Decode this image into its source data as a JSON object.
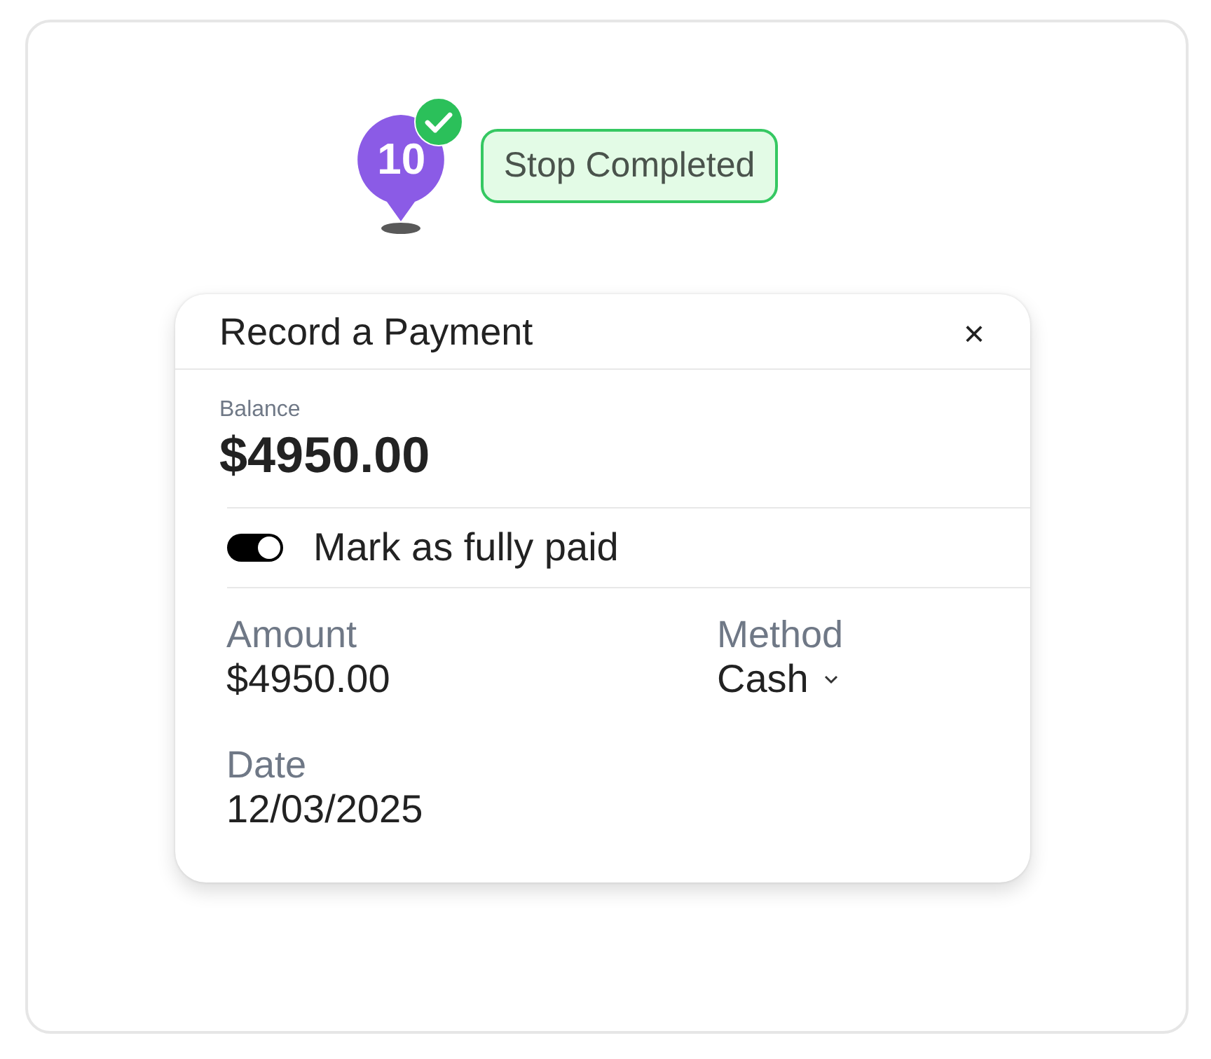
{
  "stop": {
    "number": "10",
    "completed": true,
    "status": "Stop Completed"
  },
  "dialog": {
    "title": "Record a Payment",
    "close": "×",
    "balance": {
      "label": "Balance",
      "value": "$4950.00"
    },
    "fully_paid": {
      "label": "Mark as fully paid",
      "on": true
    },
    "fields": [
      {
        "label": "Amount",
        "value": "$4950.00",
        "kind": "text"
      },
      {
        "label": "Method",
        "value": "Cash",
        "kind": "select"
      },
      {
        "label": "Date",
        "value": "12/03/2025",
        "kind": "text"
      }
    ]
  }
}
